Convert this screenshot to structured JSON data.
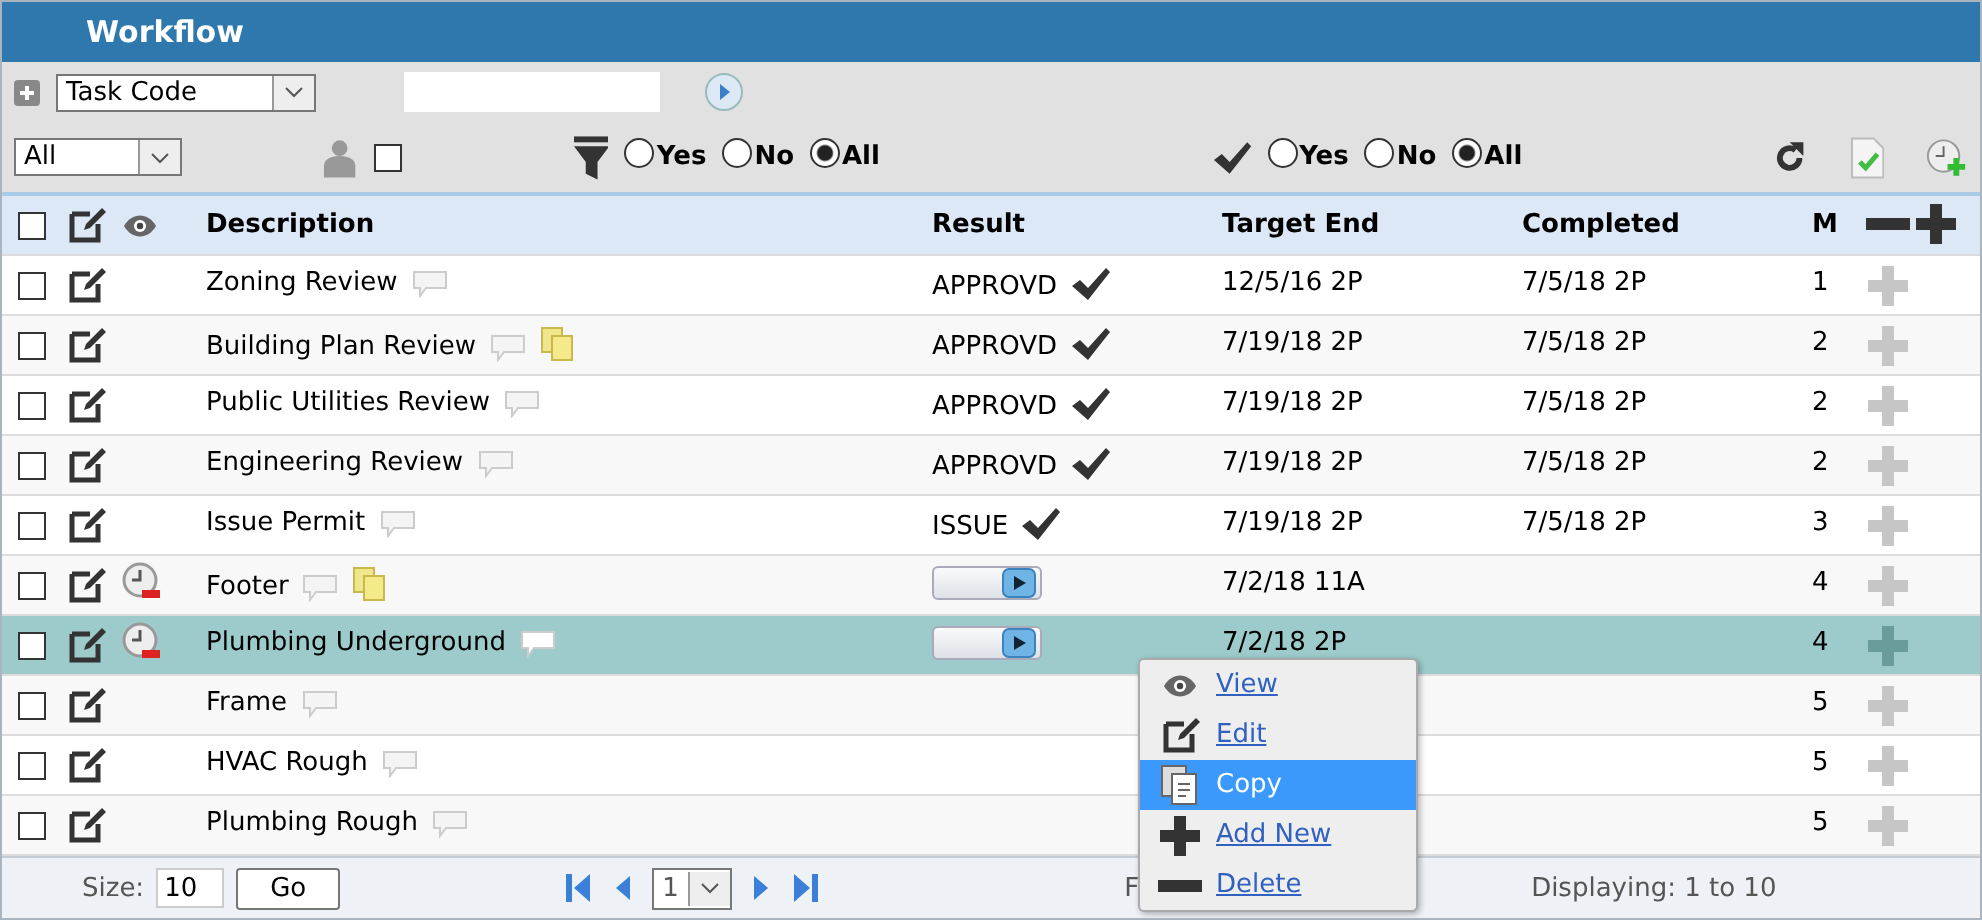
{
  "window": {
    "title": "Workflow"
  },
  "toolbar": {
    "field": "Task Code",
    "scope": "All",
    "assigned_checked": false,
    "filter_options": [
      {
        "label": "Yes",
        "selected": false
      },
      {
        "label": "No",
        "selected": false
      },
      {
        "label": "All",
        "selected": true
      }
    ],
    "complete_options": [
      {
        "label": "Yes",
        "selected": false
      },
      {
        "label": "No",
        "selected": false
      },
      {
        "label": "All",
        "selected": true
      }
    ]
  },
  "table": {
    "header_checked": false,
    "columns": [
      "Description",
      "Result",
      "Target End",
      "Completed",
      "M"
    ],
    "rows": [
      {
        "checked": false,
        "selected": false,
        "overdue": false,
        "description": "Zoning Review",
        "attachment": false,
        "result": {
          "kind": "status",
          "text": "APPROVD"
        },
        "target_end": "12/5/16 2P",
        "completed": "7/5/18 2P",
        "m": "1"
      },
      {
        "checked": false,
        "selected": false,
        "overdue": false,
        "description": "Building Plan Review",
        "attachment": true,
        "result": {
          "kind": "status",
          "text": "APPROVD"
        },
        "target_end": "7/19/18 2P",
        "completed": "7/5/18 2P",
        "m": "2"
      },
      {
        "checked": false,
        "selected": false,
        "overdue": false,
        "description": "Public Utilities Review",
        "attachment": false,
        "result": {
          "kind": "status",
          "text": "APPROVD"
        },
        "target_end": "7/19/18 2P",
        "completed": "7/5/18 2P",
        "m": "2"
      },
      {
        "checked": false,
        "selected": false,
        "overdue": false,
        "description": "Engineering Review",
        "attachment": false,
        "result": {
          "kind": "status",
          "text": "APPROVD"
        },
        "target_end": "7/19/18 2P",
        "completed": "7/5/18 2P",
        "m": "2"
      },
      {
        "checked": false,
        "selected": false,
        "overdue": false,
        "description": "Issue Permit",
        "attachment": false,
        "result": {
          "kind": "status",
          "text": "ISSUE"
        },
        "target_end": "7/19/18 2P",
        "completed": "7/5/18 2P",
        "m": "3"
      },
      {
        "checked": false,
        "selected": false,
        "overdue": true,
        "description": "Footer",
        "attachment": true,
        "result": {
          "kind": "picker"
        },
        "target_end": "7/2/18 11A",
        "m": "4"
      },
      {
        "checked": false,
        "selected": true,
        "overdue": true,
        "description": "Plumbing Underground",
        "attachment": false,
        "result": {
          "kind": "picker"
        },
        "target_end": "7/2/18 2P",
        "m": "4"
      },
      {
        "checked": false,
        "selected": false,
        "overdue": false,
        "description": "Frame",
        "attachment": false,
        "m": "5"
      },
      {
        "checked": false,
        "selected": false,
        "overdue": false,
        "description": "HVAC Rough",
        "attachment": false,
        "m": "5"
      },
      {
        "checked": false,
        "selected": false,
        "overdue": false,
        "description": "Plumbing Rough",
        "attachment": false,
        "m": "5"
      }
    ]
  },
  "footer": {
    "size_label": "Size:",
    "size": "10",
    "go": "Go",
    "page": "1",
    "found": "F",
    "displaying": "Displaying: 1 to 10"
  },
  "context_menu": [
    {
      "kind": "view",
      "label": "View",
      "selected": false
    },
    {
      "kind": "edit",
      "label": "Edit",
      "selected": false
    },
    {
      "kind": "copy",
      "label": "Copy",
      "selected": true
    },
    {
      "kind": "add",
      "label": "Add New",
      "selected": false
    },
    {
      "kind": "delete",
      "label": "Delete",
      "selected": false
    }
  ]
}
